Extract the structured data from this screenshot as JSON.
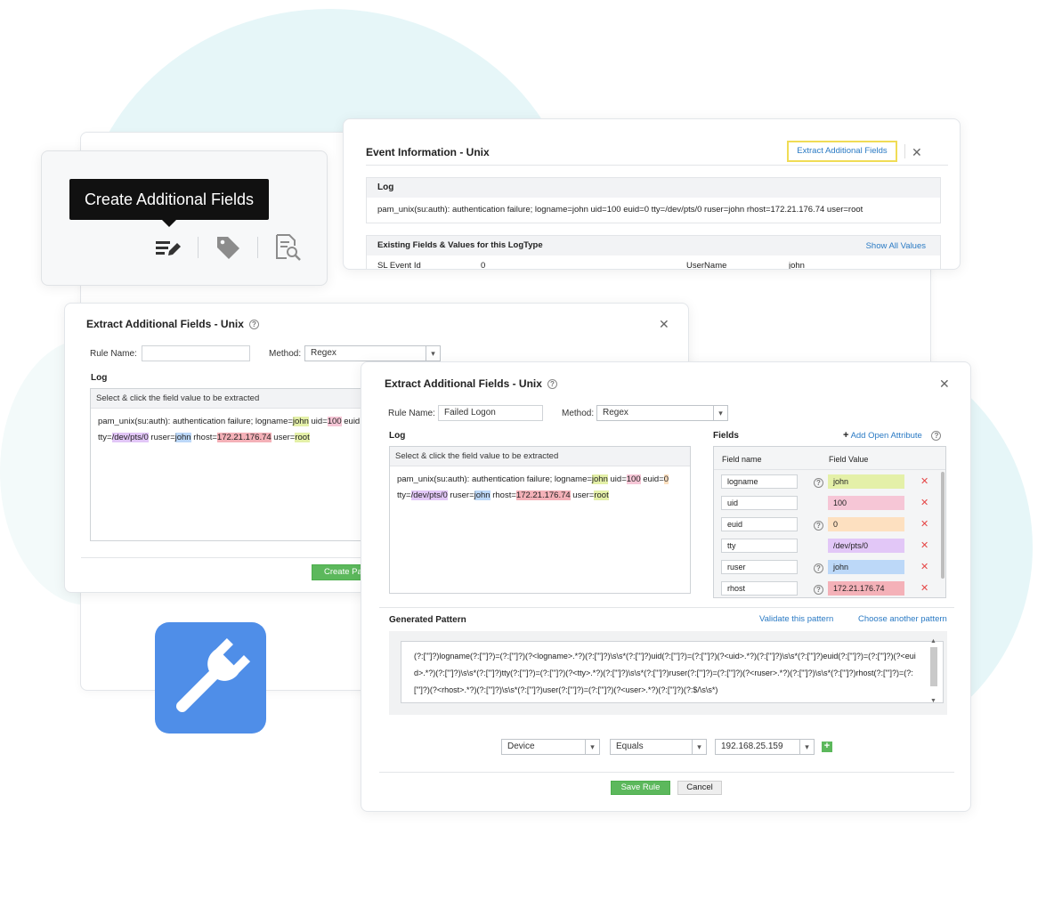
{
  "toolbar_card": {
    "tooltip": "Create Additional Fields",
    "icons": [
      "edit-list-icon",
      "tag-icon",
      "document-search-icon"
    ]
  },
  "event_info": {
    "title": "Event Information - Unix",
    "extract_link": "Extract Additional Fields",
    "log_header": "Log",
    "log_text": "pam_unix(su:auth): authentication failure; logname=john uid=100 euid=0 tty=/dev/pts/0 ruser=john rhost=172.21.176.74 user=root",
    "existing_header": "Existing Fields & Values for this LogType",
    "show_all": "Show All Values",
    "row": {
      "f1": "SL Event Id",
      "v1": "0",
      "f2": "UserName",
      "v2": "john"
    }
  },
  "extract_back": {
    "title": "Extract Additional Fields - Unix",
    "rule_label": "Rule Name:",
    "rule_value": "",
    "method_label": "Method:",
    "method_value": "Regex",
    "log_label": "Log",
    "log_header": "Select & click the field value to be extracted",
    "line1": {
      "a": "pam_unix(su:auth): authentication failure; logname=",
      "b": "john",
      "c": " uid=",
      "d": "100",
      "e": " euid"
    },
    "line2": {
      "a": "tty=",
      "b": "/dev/pts/0",
      "c": " ruser=",
      "d": "john",
      "e": " rhost=",
      "f": "172.21.176.74",
      "g": " user=",
      "h": "root"
    },
    "create_btn": "Create Pa"
  },
  "extract_front": {
    "title": "Extract Additional Fields - Unix",
    "rule_label": "Rule Name:",
    "rule_value": "Failed Logon",
    "method_label": "Method:",
    "method_value": "Regex",
    "log_label": "Log",
    "log_header": "Select & click the field value to be extracted",
    "line1": {
      "a": "pam_unix(su:auth): authentication failure; logname=",
      "b": "john",
      "c": " uid=",
      "d": "100",
      "e": " euid=",
      "f": "0"
    },
    "line2": {
      "a": "tty=",
      "b": "/dev/pts/0",
      "c": " ruser=",
      "d": "john",
      "e": " rhost=",
      "f": "172.21.176.74",
      "g": " user=",
      "h": "root"
    },
    "fields_label": "Fields",
    "add_attr": "Add Open Attribute",
    "col_name": "Field name",
    "col_value": "Field Value",
    "fields": [
      {
        "name": "logname",
        "value": "john",
        "color": "#e4f0a8",
        "help": true
      },
      {
        "name": "uid",
        "value": "100",
        "color": "#f6c6d6",
        "help": false
      },
      {
        "name": "euid",
        "value": "0",
        "color": "#fde0c0",
        "help": true
      },
      {
        "name": "tty",
        "value": "/dev/pts/0",
        "color": "#e2c7f7",
        "help": false
      },
      {
        "name": "ruser",
        "value": "john",
        "color": "#bcd8f8",
        "help": true
      },
      {
        "name": "rhost",
        "value": "172.21.176.74",
        "color": "#f4b1b8",
        "help": true
      }
    ],
    "generated_label": "Generated Pattern",
    "validate_link": "Validate this pattern",
    "choose_link": "Choose another pattern",
    "pattern": "(?:[\"']?)logname(?:[\"']?)=(?:[\"']?)(?<logname>.*?)(?:[\"']?)\\s\\s*(?:[\"']?)uid(?:[\"']?)=(?:[\"']?)(?<uid>.*?)(?:[\"']?)\\s\\s*(?:[\"']?)euid(?:[\"']?)=(?:[\"']?)(?<euid>.*?)(?:[\"']?)\\s\\s*(?:[\"']?)tty(?:[\"']?)=(?:[\"']?)(?<tty>.*?)(?:[\"']?)\\s\\s*(?:[\"']?)ruser(?:[\"']?)=(?:[\"']?)(?<ruser>.*?)(?:[\"']?)\\s\\s*(?:[\"']?)rhost(?:[\"']?)=(?:[\"']?)(?<rhost>.*?)(?:[\"']?)\\s\\s*(?:[\"']?)user(?:[\"']?)=(?:[\"']?)(?<user>.*?)(?:[\"']?)(?:$/\\s\\s*)",
    "filter": {
      "field": "Device",
      "op": "Equals",
      "value": "192.168.25.159"
    },
    "save_btn": "Save Rule",
    "cancel_btn": "Cancel"
  },
  "colors": {
    "accent_link": "#2a7ac4",
    "green_button": "#5cb85c",
    "wrench_tile": "#4f8ee8",
    "delete_red": "#e54848",
    "highlight_outline": "#f0dc55"
  }
}
